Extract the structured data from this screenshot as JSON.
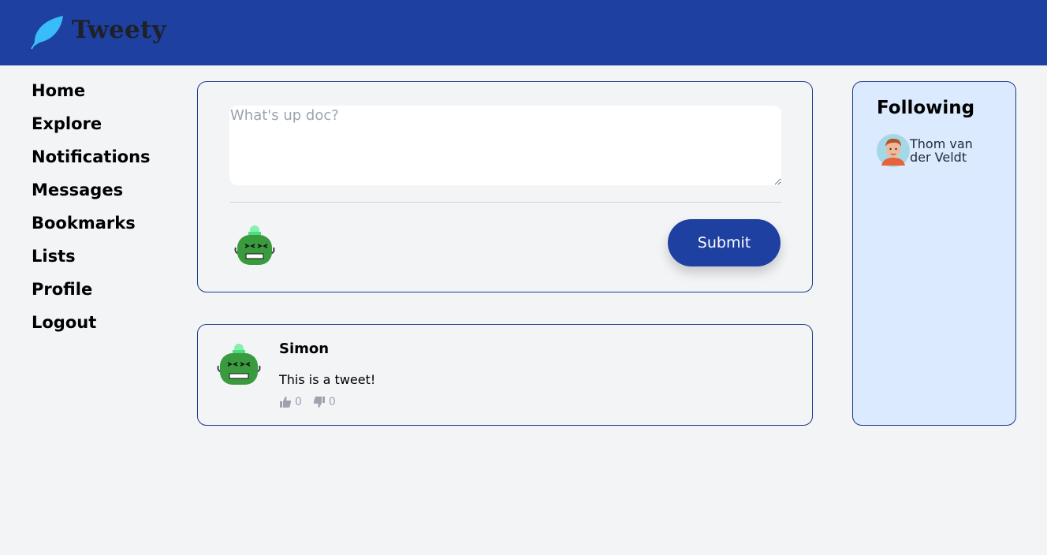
{
  "header": {
    "app_name": "Tweety",
    "brand_color": "#1e40a0",
    "logo_icon": "feather-icon"
  },
  "nav": {
    "items": [
      {
        "label": "Home"
      },
      {
        "label": "Explore"
      },
      {
        "label": "Notifications"
      },
      {
        "label": "Messages"
      },
      {
        "label": "Bookmarks"
      },
      {
        "label": "Lists"
      },
      {
        "label": "Profile"
      },
      {
        "label": "Logout"
      }
    ]
  },
  "compose": {
    "placeholder": "What's up doc?",
    "value": "",
    "submit_label": "Submit",
    "avatar_icon": "robot-avatar-icon"
  },
  "tweets": [
    {
      "author": "Simon",
      "text": "This is a tweet!",
      "likes": "0",
      "dislikes": "0",
      "avatar_icon": "robot-avatar-icon"
    }
  ],
  "following": {
    "title": "Following",
    "users": [
      {
        "name": "Thom van der Veldt",
        "avatar_icon": "person-avatar-icon"
      }
    ]
  }
}
